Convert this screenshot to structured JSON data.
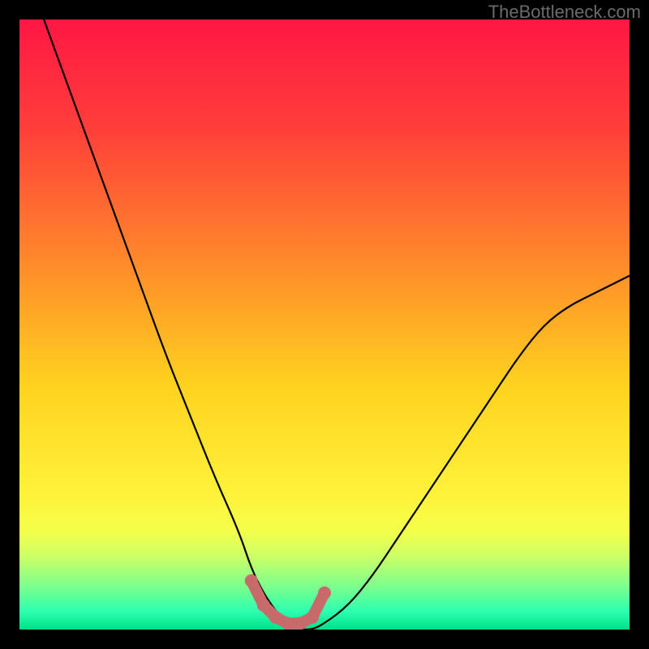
{
  "watermark": "TheBottleneck.com",
  "chart_data": {
    "type": "line",
    "title": "",
    "xlabel": "",
    "ylabel": "",
    "xlim": [
      0,
      100
    ],
    "ylim": [
      0,
      100
    ],
    "series": [
      {
        "name": "bottleneck-curve",
        "x": [
          4,
          8,
          12,
          16,
          20,
          24,
          28,
          32,
          36,
          38,
          40,
          42,
          44,
          46,
          48,
          50,
          54,
          58,
          62,
          66,
          70,
          74,
          78,
          82,
          86,
          90,
          94,
          98,
          100
        ],
        "y": [
          100,
          89,
          78,
          67,
          56,
          45,
          35,
          25,
          16,
          10,
          6,
          3,
          1,
          0,
          0,
          1,
          4,
          9,
          15,
          21,
          27,
          33,
          39,
          45,
          50,
          53,
          55,
          57,
          58
        ]
      }
    ],
    "highlight": {
      "name": "valley-marker",
      "x": [
        38,
        40,
        42,
        44,
        46,
        48,
        50
      ],
      "y": [
        8,
        4,
        2,
        1,
        1,
        2,
        6
      ]
    },
    "gradient_bands": [
      {
        "offset": 0.0,
        "color": "#ff1744"
      },
      {
        "offset": 0.18,
        "color": "#ff3f3a"
      },
      {
        "offset": 0.4,
        "color": "#ff8a2a"
      },
      {
        "offset": 0.6,
        "color": "#ffd21f"
      },
      {
        "offset": 0.78,
        "color": "#fff23a"
      },
      {
        "offset": 0.84,
        "color": "#f3ff4a"
      },
      {
        "offset": 0.88,
        "color": "#ccff66"
      },
      {
        "offset": 0.93,
        "color": "#7bff8e"
      },
      {
        "offset": 0.97,
        "color": "#2dffb0"
      },
      {
        "offset": 1.0,
        "color": "#00e08a"
      }
    ]
  }
}
